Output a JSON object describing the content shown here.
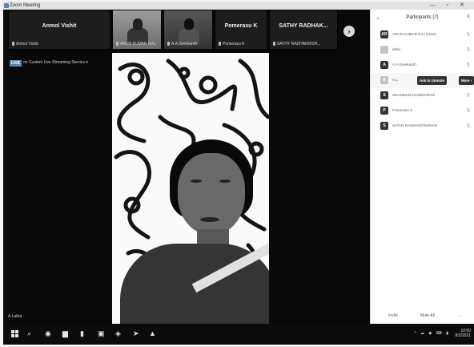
{
  "window": {
    "title": "Zoom Meeting",
    "controls": "— ▫ ✕"
  },
  "strip": {
    "tiles": [
      {
        "big": "Anmol Vishit",
        "small": "Anmol Vishit"
      },
      {
        "big": "",
        "small": "ARUN KUMAR RAJ"
      },
      {
        "big": "",
        "small": "A.A.Sreekanth"
      },
      {
        "big": "Pomerasu K",
        "small": "Pomerasu K"
      },
      {
        "big": "SATHY RADHAK...",
        "small": "SATHY RADHAKRISH..."
      }
    ],
    "next": "›"
  },
  "live": {
    "badge": "LIVE",
    "text": "on Custom Live Streaming Service ▾"
  },
  "speaker_name": "A.Latha",
  "panel": {
    "title": "Participants (7)",
    "collapse_glyph": "⌄",
    "popout_glyph": "⇱",
    "participants": [
      {
        "initial": "AR",
        "name": "ARUN KUMAR RAJ (Host)",
        "status": "🎙"
      },
      {
        "initial": "",
        "name": "latha",
        "status": "🎙"
      },
      {
        "initial": "A",
        "name": "A.A.Sreekanth",
        "status": "🎙"
      },
      {
        "initial": "A",
        "name": "A.L",
        "status": ""
      },
      {
        "initial": "S",
        "name": "SHANMUGASUNDARAM",
        "status": "🎙"
      },
      {
        "initial": "P",
        "name": "Pomerasu K",
        "status": "🎙"
      },
      {
        "initial": "S",
        "name": "SATHY RADHAKRISHNAN",
        "status": "🎙"
      }
    ],
    "ask_unmute": "Ask to Unmute",
    "more": "More ›",
    "footer": {
      "invite": "Invite",
      "mute_all": "Mute All",
      "more": "..."
    }
  },
  "taskbar": {
    "glyphs": [
      "⌕",
      "◉",
      "▆",
      "▮",
      "▣",
      "◈",
      "➤",
      "▲"
    ],
    "tray_icons": "^ ☁ ◆ ⌨ ▮",
    "time": "10:50",
    "date": "8/2/2021"
  }
}
